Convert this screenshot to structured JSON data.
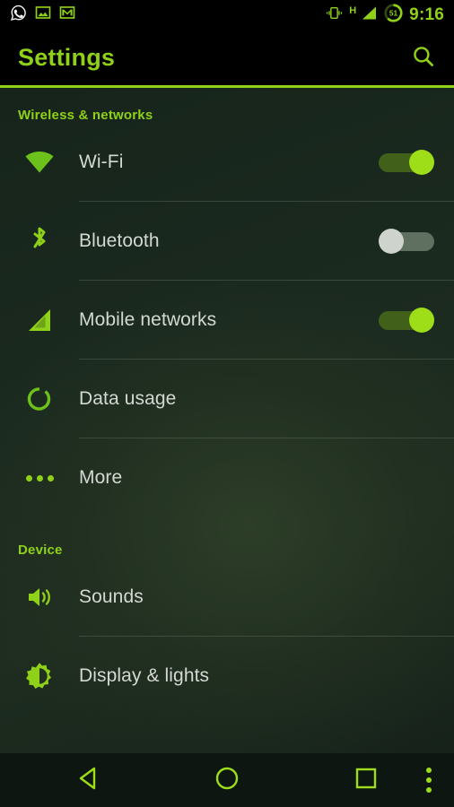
{
  "status_bar": {
    "time": "9:16",
    "network_type": "H",
    "battery_level": "51",
    "left_icons": [
      {
        "name": "whatsapp-icon",
        "label": "WhatsApp"
      },
      {
        "name": "gallery-icon",
        "label": "Gallery"
      },
      {
        "name": "gmail-icon",
        "label": "Gmail"
      }
    ],
    "right_icons": [
      {
        "name": "vibrate-icon",
        "label": "Vibrate"
      },
      {
        "name": "signal-icon",
        "label": "Signal strength"
      },
      {
        "name": "battery-icon",
        "label": "Battery"
      }
    ]
  },
  "app_bar": {
    "title": "Settings",
    "search_label": "Search"
  },
  "sections": [
    {
      "header": "Wireless & networks",
      "rows": [
        {
          "label": "Wi-Fi",
          "icon": "wifi-icon",
          "control": "toggle",
          "state": "on",
          "divider": true
        },
        {
          "label": "Bluetooth",
          "icon": "bluetooth-icon",
          "control": "toggle",
          "state": "off",
          "divider": true
        },
        {
          "label": "Mobile networks",
          "icon": "signal-icon",
          "control": "toggle",
          "state": "on",
          "divider": true
        },
        {
          "label": "Data usage",
          "icon": "data-usage-icon",
          "control": "none",
          "state": "",
          "divider": true
        },
        {
          "label": "More",
          "icon": "more-icon",
          "control": "none",
          "state": "",
          "divider": false
        }
      ]
    },
    {
      "header": "Device",
      "rows": [
        {
          "label": "Sounds",
          "icon": "sound-icon",
          "control": "none",
          "state": "",
          "divider": true
        },
        {
          "label": "Display & lights",
          "icon": "brightness-icon",
          "control": "none",
          "state": "",
          "divider": false
        }
      ]
    }
  ],
  "nav_bar": {
    "back_label": "Back",
    "home_label": "Home",
    "recents_label": "Recent apps",
    "menu_label": "Menu"
  },
  "colors": {
    "accent": "#8fd118",
    "toggle_on_thumb": "#9ede19",
    "toggle_on_track": "#41611a",
    "toggle_off_thumb": "#cfd3cd",
    "toggle_off_track": "#5f6f60",
    "background": "#18271d",
    "status_bar_bg": "#000000",
    "row_label": "#d4d8d2"
  }
}
